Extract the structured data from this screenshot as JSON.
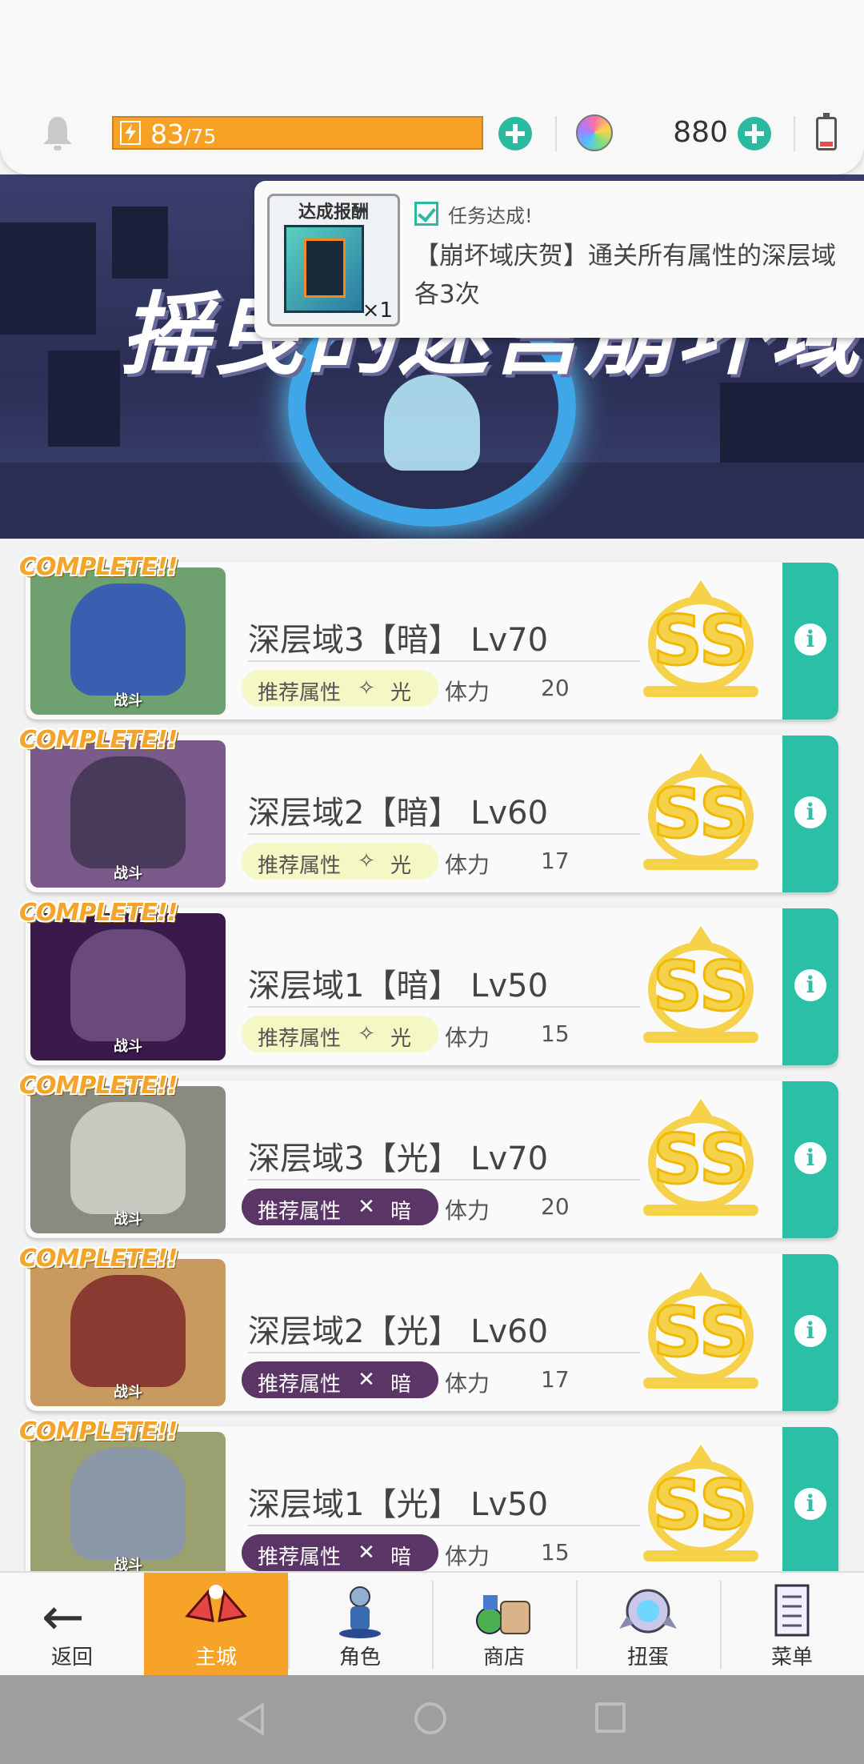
{
  "header": {
    "energy_current": "83",
    "energy_max": "/75",
    "gem_count": "880"
  },
  "banner": {
    "title": "摇曳的迷宫崩坏域"
  },
  "popup": {
    "reward_title": "达成报酬",
    "reward_qty": "×1",
    "status": "任务达成!",
    "description": "【崩坏域庆贺】通关所有属性的深层域各3次"
  },
  "stages": [
    {
      "badge": "COMPLETE!!",
      "thumb_label": "战斗",
      "title": "深层域3【暗】 Lv70",
      "attr_label": "推荐属性",
      "attr_icon": "✧",
      "attr_name": "光",
      "attr_style": "light",
      "stamina_label": "体力",
      "stamina": "20",
      "rank": "SS",
      "thumb_bg": "#6fa070",
      "monster_color": "#3a5fb0"
    },
    {
      "badge": "COMPLETE!!",
      "thumb_label": "战斗",
      "title": "深层域2【暗】 Lv60",
      "attr_label": "推荐属性",
      "attr_icon": "✧",
      "attr_name": "光",
      "attr_style": "light",
      "stamina_label": "体力",
      "stamina": "17",
      "rank": "SS",
      "thumb_bg": "#7a5a8a",
      "monster_color": "#4a3a5a"
    },
    {
      "badge": "COMPLETE!!",
      "thumb_label": "战斗",
      "title": "深层域1【暗】 Lv50",
      "attr_label": "推荐属性",
      "attr_icon": "✧",
      "attr_name": "光",
      "attr_style": "light",
      "stamina_label": "体力",
      "stamina": "15",
      "rank": "SS",
      "thumb_bg": "#3a1a4a",
      "monster_color": "#6a4a7a"
    },
    {
      "badge": "COMPLETE!!",
      "thumb_label": "战斗",
      "title": "深层域3【光】 Lv70",
      "attr_label": "推荐属性",
      "attr_icon": "✕",
      "attr_name": "暗",
      "attr_style": "dark",
      "stamina_label": "体力",
      "stamina": "20",
      "rank": "SS",
      "thumb_bg": "#8a8a80",
      "monster_color": "#c8c8c0"
    },
    {
      "badge": "COMPLETE!!",
      "thumb_label": "战斗",
      "title": "深层域2【光】 Lv60",
      "attr_label": "推荐属性",
      "attr_icon": "✕",
      "attr_name": "暗",
      "attr_style": "dark",
      "stamina_label": "体力",
      "stamina": "17",
      "rank": "SS",
      "thumb_bg": "#c89a60",
      "monster_color": "#8a3a30"
    },
    {
      "badge": "COMPLETE!!",
      "thumb_label": "战斗",
      "title": "深层域1【光】 Lv50",
      "attr_label": "推荐属性",
      "attr_icon": "✕",
      "attr_name": "暗",
      "attr_style": "dark",
      "stamina_label": "体力",
      "stamina": "15",
      "rank": "SS",
      "thumb_bg": "#9aa070",
      "monster_color": "#8a98a8"
    }
  ],
  "nav": [
    {
      "label": "返回",
      "icon": "back-arrow-icon"
    },
    {
      "label": "主城",
      "icon": "castle-icon",
      "active": true
    },
    {
      "label": "角色",
      "icon": "character-icon"
    },
    {
      "label": "商店",
      "icon": "shop-icon"
    },
    {
      "label": "扭蛋",
      "icon": "gacha-icon"
    },
    {
      "label": "菜单",
      "icon": "menu-icon"
    }
  ],
  "colors": {
    "accent": "#2bbfa8",
    "energy": "#f7a224",
    "rank_gold": "#f6d24a",
    "dark_attr": "#5a3566",
    "light_attr": "#f3f8c4"
  }
}
